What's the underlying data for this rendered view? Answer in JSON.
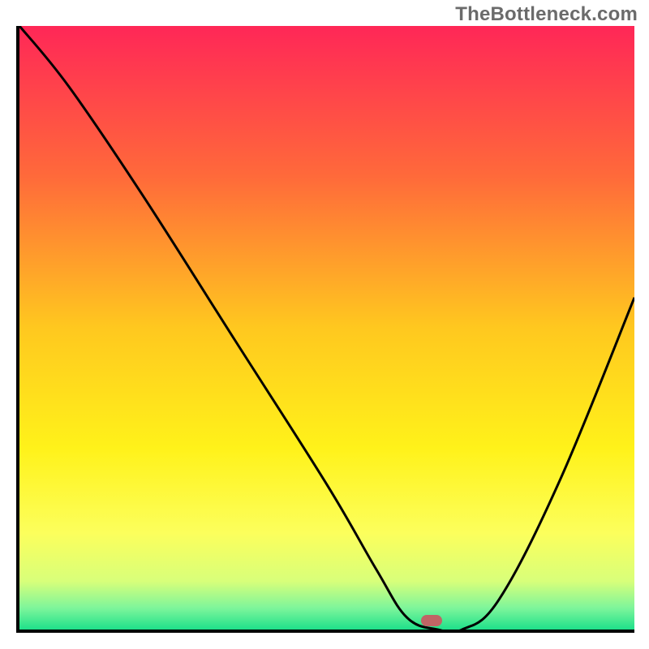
{
  "watermark": "TheBottleneck.com",
  "chart_data": {
    "type": "line",
    "title": "",
    "xlabel": "",
    "ylabel": "",
    "xlim": [
      0,
      100
    ],
    "ylim": [
      0,
      100
    ],
    "grid": false,
    "legend": false,
    "gradient_stops": [
      {
        "pos": 0,
        "color": "#ff2757"
      },
      {
        "pos": 0.25,
        "color": "#ff6a3a"
      },
      {
        "pos": 0.5,
        "color": "#ffc81f"
      },
      {
        "pos": 0.7,
        "color": "#fff21a"
      },
      {
        "pos": 0.84,
        "color": "#fcff5c"
      },
      {
        "pos": 0.92,
        "color": "#d8ff7a"
      },
      {
        "pos": 0.965,
        "color": "#7cf59b"
      },
      {
        "pos": 1.0,
        "color": "#1ee08a"
      }
    ],
    "series": [
      {
        "name": "bottleneck-curve",
        "x": [
          0,
          8,
          20,
          35,
          50,
          58,
          63,
          68,
          72,
          78,
          88,
          100
        ],
        "values": [
          100,
          90,
          72,
          48,
          24,
          10,
          2,
          0,
          0,
          5,
          25,
          55
        ]
      }
    ],
    "marker": {
      "x": 67,
      "y": 1.5,
      "color": "#c06565",
      "width": 3.4,
      "height": 1.8
    }
  }
}
